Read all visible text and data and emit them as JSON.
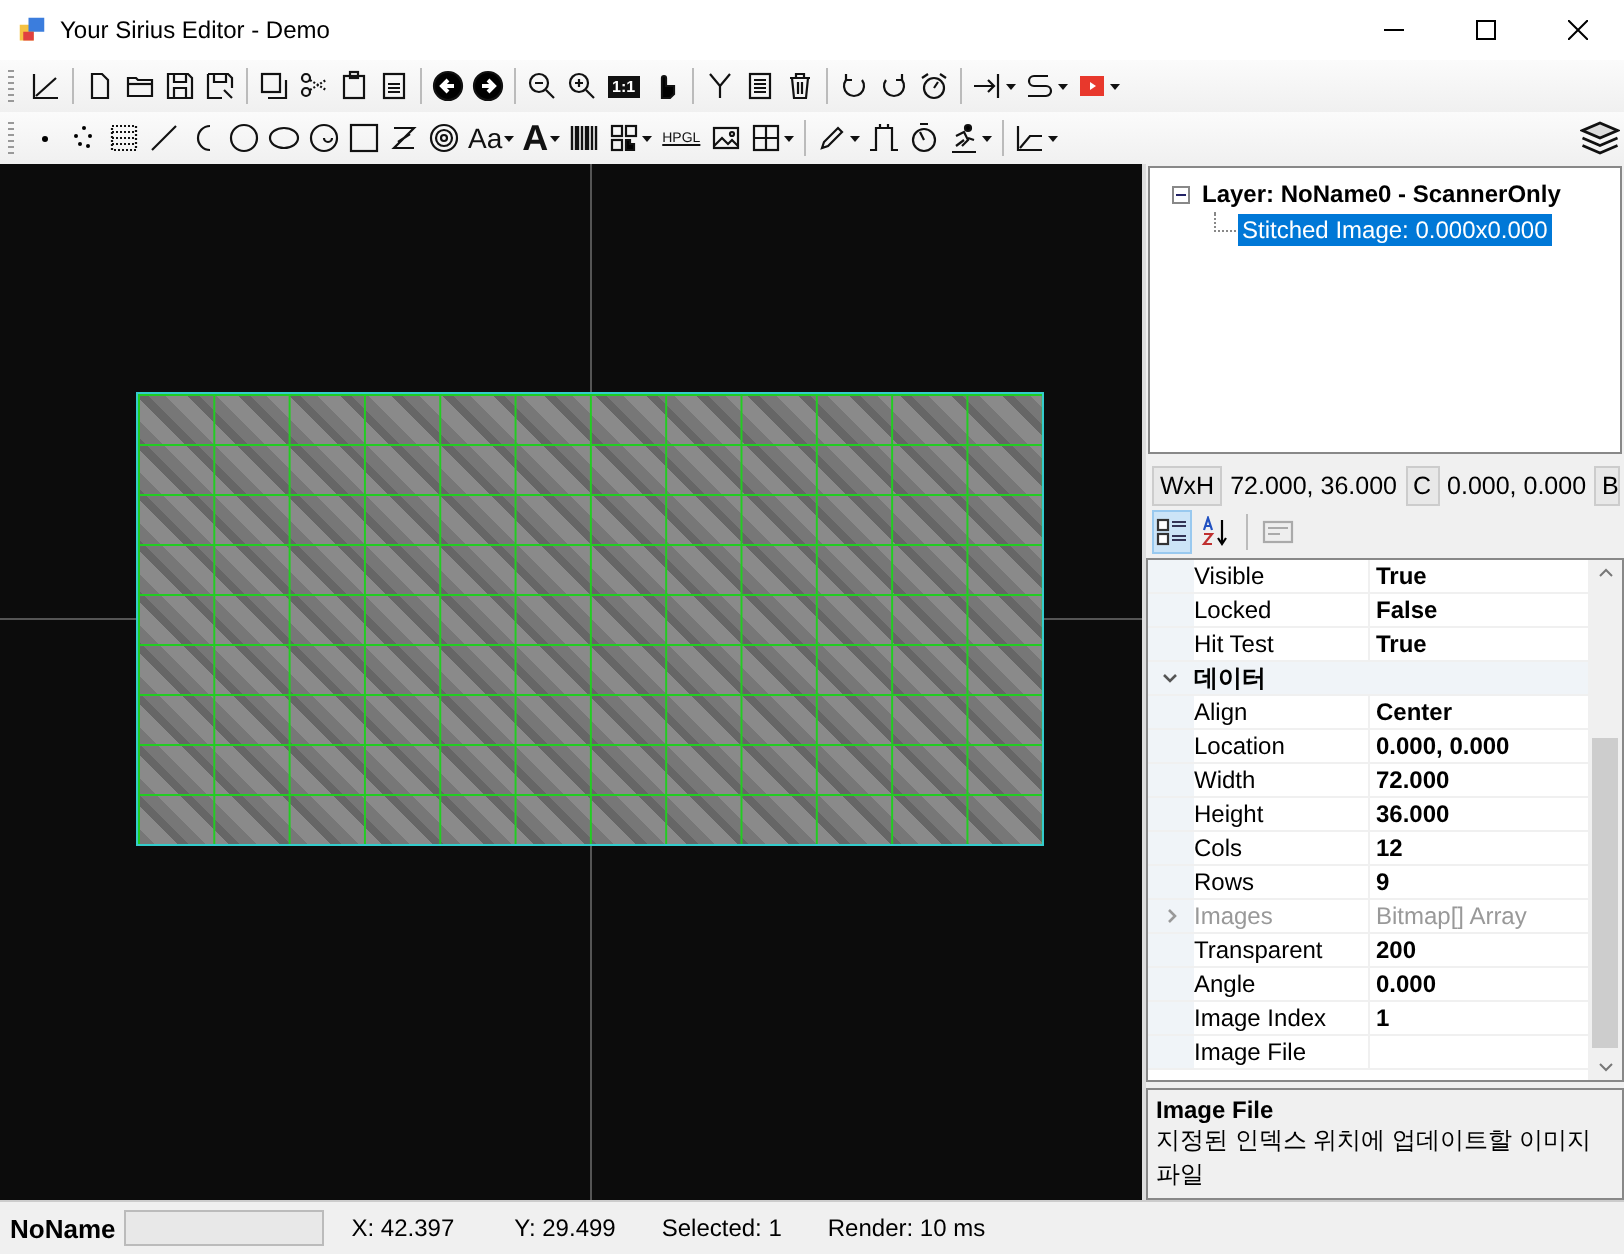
{
  "window": {
    "title": "Your Sirius Editor - Demo"
  },
  "toolbar_texts": {
    "zoom_actual": "1:1",
    "font_style": "Aa",
    "text_tool": "A",
    "hpgl": "HPGL"
  },
  "tree": [
    {
      "label": "Layer: NoName0 - ScannerOnly",
      "expanded": true,
      "selected": false,
      "children": [
        {
          "label": "Stitched Image: 0.000x0.000",
          "selected": true
        }
      ]
    }
  ],
  "size_bar": {
    "wxh_label": "WxH",
    "wxh_value": "72.000, 36.000",
    "c_label": "C",
    "c_value": "0.000, 0.000",
    "b_label": "B"
  },
  "property_grid": [
    {
      "kind": "property",
      "name": "Visible",
      "value": "True",
      "disabled": false
    },
    {
      "kind": "property",
      "name": "Locked",
      "value": "False",
      "disabled": false
    },
    {
      "kind": "property",
      "name": "Hit Test",
      "value": "True",
      "disabled": false
    },
    {
      "kind": "category",
      "name": "데이터",
      "expanded": true
    },
    {
      "kind": "property",
      "name": "Align",
      "value": "Center",
      "disabled": false
    },
    {
      "kind": "property",
      "name": "Location",
      "value": "0.000, 0.000",
      "disabled": false
    },
    {
      "kind": "property",
      "name": "Width",
      "value": "72.000",
      "disabled": false
    },
    {
      "kind": "property",
      "name": "Height",
      "value": "36.000",
      "disabled": false
    },
    {
      "kind": "property",
      "name": "Cols",
      "value": "12",
      "disabled": false
    },
    {
      "kind": "property",
      "name": "Rows",
      "value": "9",
      "disabled": false
    },
    {
      "kind": "expandable",
      "name": "Images",
      "value": "Bitmap[] Array",
      "disabled": true,
      "expanded": false
    },
    {
      "kind": "property",
      "name": "Transparent",
      "value": "200",
      "disabled": false
    },
    {
      "kind": "property",
      "name": "Angle",
      "value": "0.000",
      "disabled": false
    },
    {
      "kind": "property",
      "name": "Image Index",
      "value": "1",
      "disabled": false
    },
    {
      "kind": "property",
      "name": "Image File",
      "disabled": false
    }
  ],
  "description": {
    "title": "Image File",
    "text": "지정된 인덱스 위치에 업데이트할 이미지 파일"
  },
  "status_bar": {
    "document": "NoName",
    "x": "X: 42.397",
    "y": "Y: 29.499",
    "selected": "Selected: 1",
    "render": "Render: 10 ms"
  }
}
